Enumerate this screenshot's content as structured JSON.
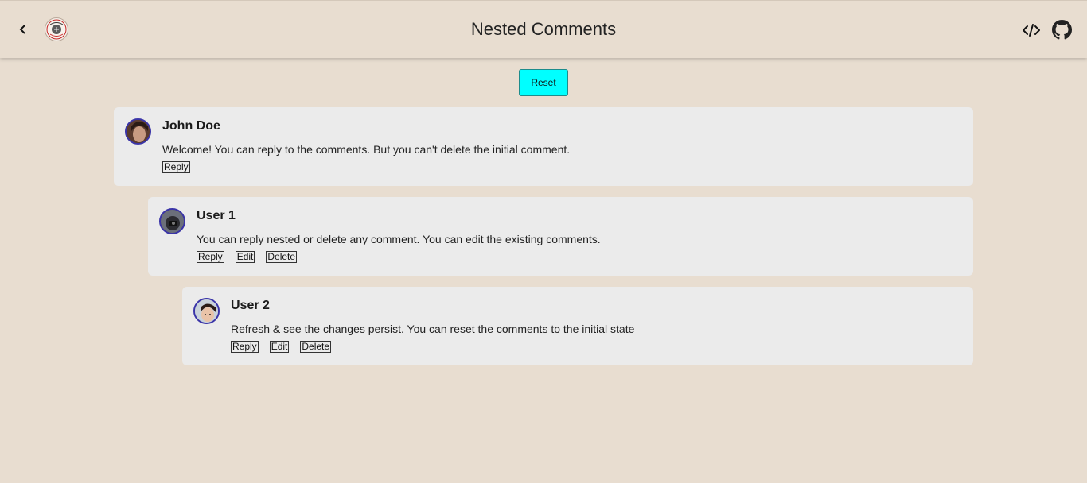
{
  "header": {
    "title": "Nested Comments",
    "back_icon": "chevron-left-icon",
    "logo_icon": "site-logo",
    "code_icon": "code-icon",
    "github_icon": "github-icon"
  },
  "reset_label": "Reset",
  "colors": {
    "background": "#e8ddd0",
    "card": "#ebebeb",
    "reset_button": "#00ffff",
    "avatar_border": "#3a34a8"
  },
  "comments": [
    {
      "name": "John Doe",
      "text": "Welcome! You can reply to the comments. But you can't delete the initial comment.",
      "reply_label": "Reply"
    },
    {
      "name": "User 1",
      "text": "You can reply nested or delete any comment. You can edit the existing comments.",
      "reply_label": "Reply",
      "edit_label": "Edit",
      "delete_label": "Delete"
    },
    {
      "name": "User 2",
      "text": "Refresh & see the changes persist. You can reset the comments to the initial state",
      "reply_label": "Reply",
      "edit_label": "Edit",
      "delete_label": "Delete"
    }
  ]
}
